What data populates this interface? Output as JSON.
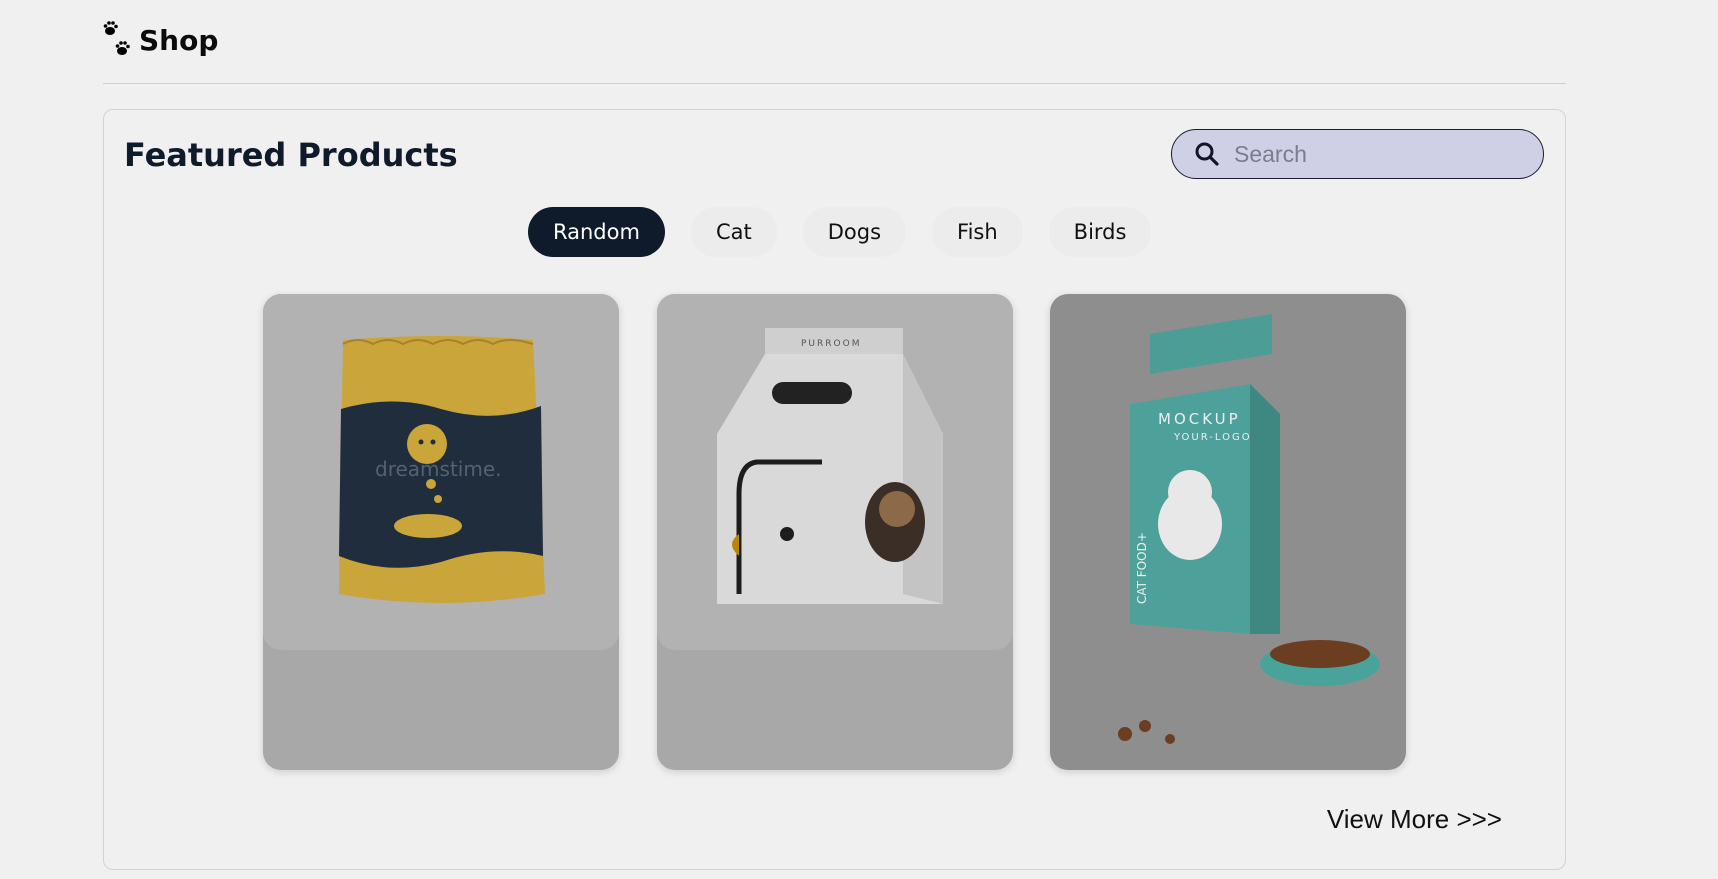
{
  "header": {
    "brand": "Shop",
    "logo_icon": "paw-prints-icon"
  },
  "main": {
    "title": "Featured Products",
    "search": {
      "placeholder": "Search",
      "value": "",
      "icon": "search-icon"
    },
    "tabs": [
      {
        "label": "Random",
        "active": true
      },
      {
        "label": "Cat",
        "active": false
      },
      {
        "label": "Dogs",
        "active": false
      },
      {
        "label": "Fish",
        "active": false
      },
      {
        "label": "Birds",
        "active": false
      }
    ],
    "products": [
      {
        "image": "cat-food-bag-image",
        "watermark": "dreamstime."
      },
      {
        "image": "cat-house-box-image",
        "box_text": "PURROOM"
      },
      {
        "image": "cat-food-carton-image",
        "carton_text": "MOCKUP",
        "carton_subtext": "YOUR-LOGO",
        "side_text": "CAT FOOD+"
      }
    ],
    "view_more": "View More >>>"
  },
  "colors": {
    "background": "#f0f0f0",
    "active_tab": "#0f1a2b",
    "search_bg": "#cfd0e5",
    "card_bg": "#a8a8a8"
  }
}
